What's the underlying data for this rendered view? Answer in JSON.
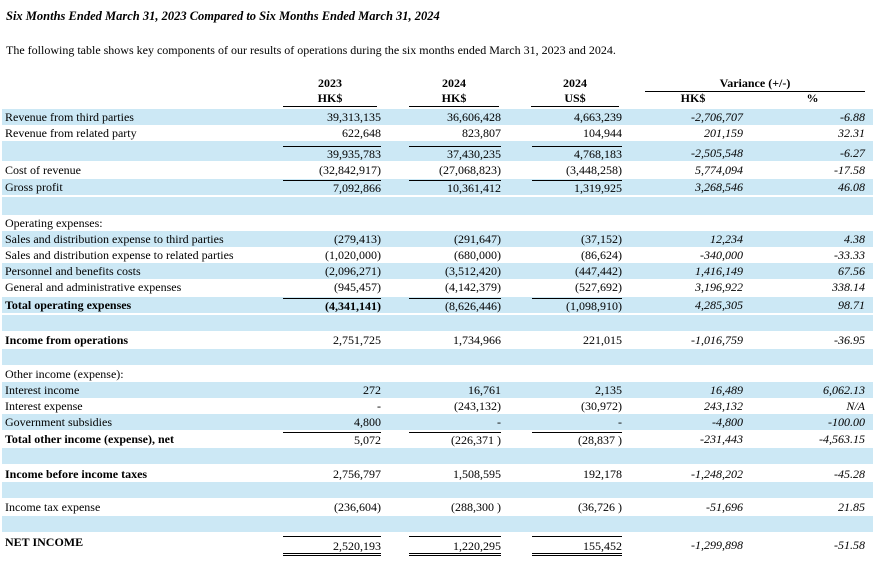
{
  "title": "Six Months Ended March 31, 2023 Compared to Six Months Ended March 31, 2024",
  "intro": "The following table shows key components of our results of operations during the six months ended March 31, 2023 and 2024.",
  "headers": {
    "col1_year": "2023",
    "col1_cur": "HK$",
    "col2_year": "2024",
    "col2_cur": "HK$",
    "col3_year": "2024",
    "col3_cur": "US$",
    "variance": "Variance (+/-)",
    "var_cur": "HK$",
    "var_pct": "%"
  },
  "rows": [
    {
      "label": "Revenue from third parties",
      "v2023": "39,313,135",
      "v2024": "36,606,428",
      "usd": "4,663,239",
      "var": "-2,706,707",
      "pct": "-6.88"
    },
    {
      "label": "Revenue from related party",
      "v2023": "622,648",
      "v2024": "823,807",
      "usd": "104,944",
      "var": "201,159",
      "pct": "32.31"
    },
    {
      "label": "",
      "v2023": "39,935,783",
      "v2024": "37,430,235",
      "usd": "4,768,183",
      "var": "-2,505,548",
      "pct": "-6.27"
    },
    {
      "label": "Cost of revenue",
      "v2023": "(32,842,917)",
      "v2024": "(27,068,823)",
      "usd": "(3,448,258)",
      "var": "5,774,094",
      "pct": "-17.58"
    },
    {
      "label": "Gross profit",
      "v2023": "7,092,866",
      "v2024": "10,361,412",
      "usd": "1,319,925",
      "var": "3,268,546",
      "pct": "46.08"
    },
    {
      "label": "Operating expenses:",
      "v2023": "",
      "v2024": "",
      "usd": "",
      "var": "",
      "pct": ""
    },
    {
      "label": "Sales and distribution expense to third parties",
      "v2023": "(279,413)",
      "v2024": "(291,647)",
      "usd": "(37,152)",
      "var": "12,234",
      "pct": "4.38"
    },
    {
      "label": "Sales and distribution expense to related parties",
      "v2023": "(1,020,000)",
      "v2024": "(680,000)",
      "usd": "(86,624)",
      "var": "-340,000",
      "pct": "-33.33"
    },
    {
      "label": "Personnel and benefits costs",
      "v2023": "(2,096,271)",
      "v2024": "(3,512,420)",
      "usd": "(447,442)",
      "var": "1,416,149",
      "pct": "67.56"
    },
    {
      "label": "General and administrative expenses",
      "v2023": "(945,457)",
      "v2024": "(4,142,379)",
      "usd": "(527,692)",
      "var": "3,196,922",
      "pct": "338.14"
    },
    {
      "label": "Total operating expenses",
      "v2023": "(4,341,141)",
      "v2024": "(8,626,446)",
      "usd": "(1,098,910)",
      "var": "4,285,305",
      "pct": "98.71"
    },
    {
      "label": "Income from operations",
      "v2023": "2,751,725",
      "v2024": "1,734,966",
      "usd": "221,015",
      "var": "-1,016,759",
      "pct": "-36.95"
    },
    {
      "label": "Other income (expense):",
      "v2023": "",
      "v2024": "",
      "usd": "",
      "var": "",
      "pct": ""
    },
    {
      "label": "Interest income",
      "v2023": "272",
      "v2024": "16,761",
      "usd": "2,135",
      "var": "16,489",
      "pct": "6,062.13"
    },
    {
      "label": "Interest expense",
      "v2023": "-",
      "v2024": "(243,132)",
      "usd": "(30,972)",
      "var": "243,132",
      "pct": "N/A"
    },
    {
      "label": "Government subsidies",
      "v2023": "4,800",
      "v2024": "-",
      "usd": "-",
      "var": "-4,800",
      "pct": "-100.00"
    },
    {
      "label": "Total other income (expense), net",
      "v2023": "5,072",
      "v2024": "(226,371 )",
      "usd": "(28,837 )",
      "var": "-231,443",
      "pct": "-4,563.15"
    },
    {
      "label": "Income before income taxes",
      "v2023": "2,756,797",
      "v2024": "1,508,595",
      "usd": "192,178",
      "var": "-1,248,202",
      "pct": "-45.28"
    },
    {
      "label": "Income tax expense",
      "v2023": "(236,604)",
      "v2024": "(288,300 )",
      "usd": "(36,726 )",
      "var": "-51,696",
      "pct": "21.85"
    },
    {
      "label": "NET INCOME",
      "v2023": "2,520,193",
      "v2024": "1,220,295",
      "usd": "155,452",
      "var": "-1,299,898",
      "pct": "-51.58"
    }
  ]
}
